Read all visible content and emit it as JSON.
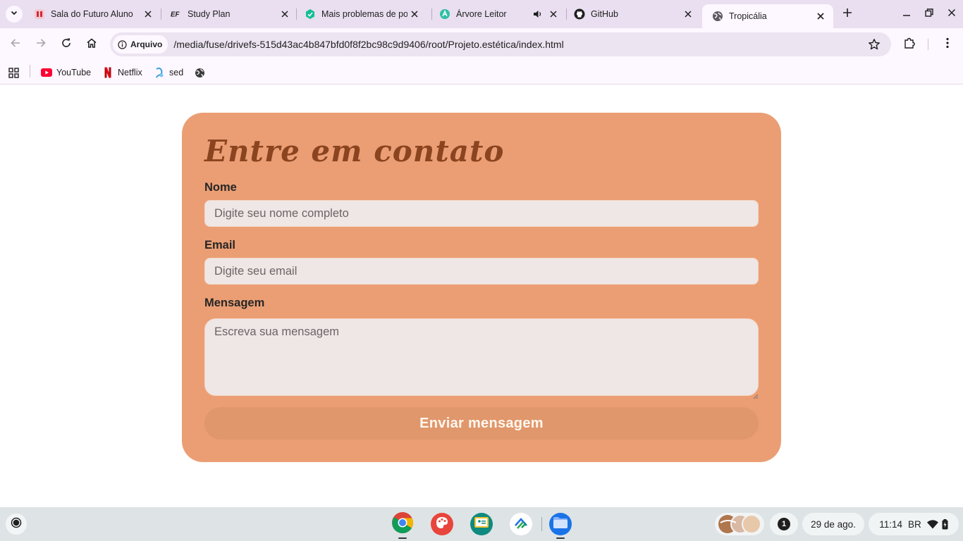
{
  "browser": {
    "tabs": [
      {
        "title": "Sala do Futuro Aluno",
        "icon": "sala-do-futuro-icon",
        "active": false
      },
      {
        "title": "Study Plan",
        "icon": "ef-icon",
        "active": false
      },
      {
        "title": "Mais problemas de po",
        "icon": "khan-academy-icon",
        "active": false
      },
      {
        "title": "Árvore Leitor",
        "icon": "arvore-icon",
        "active": false,
        "audio": true
      },
      {
        "title": "GitHub",
        "icon": "github-icon",
        "active": false
      },
      {
        "title": "Tropicália",
        "icon": "globe-icon",
        "active": true
      }
    ],
    "omnibox": {
      "chip_label": "Arquivo",
      "url": "/media/fuse/drivefs-515d43ac4b847bfd0f8f2bc98c9d9406/root/Projeto.estética/index.html"
    },
    "bookmarks": [
      {
        "label": "YouTube",
        "icon": "youtube-icon"
      },
      {
        "label": "Netflix",
        "icon": "netflix-icon"
      },
      {
        "label": "sed",
        "icon": "sed-icon"
      },
      {
        "label": "",
        "icon": "globe-icon"
      }
    ]
  },
  "form": {
    "title": "Entre em contato",
    "name_label": "Nome",
    "name_placeholder": "Digite seu nome completo",
    "email_label": "Email",
    "email_placeholder": "Digite seu email",
    "message_label": "Mensagem",
    "message_placeholder": "Escreva sua mensagem",
    "submit_label": "Enviar mensagem"
  },
  "colors": {
    "card": "#eb9e74",
    "title": "#8a441f",
    "button": "#e0976b",
    "field": "#efe6e6"
  },
  "shelf": {
    "apps": [
      "chrome-icon",
      "canvas-icon",
      "google-classroom-icon",
      "tapestry-icon",
      "files-icon"
    ],
    "notification_count": "1",
    "date": "29 de ago.",
    "time": "11:14",
    "input_method": "BR"
  }
}
